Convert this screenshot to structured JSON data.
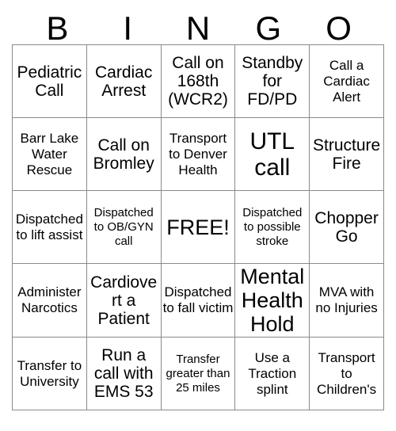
{
  "header": {
    "letters": [
      "B",
      "I",
      "N",
      "G",
      "O"
    ]
  },
  "grid": {
    "rows": [
      [
        {
          "text": "Pediatric Call",
          "size": "md"
        },
        {
          "text": "Cardiac Arrest",
          "size": "md"
        },
        {
          "text": "Call on 168th (WCR2)",
          "size": "md"
        },
        {
          "text": "Standby for FD/PD",
          "size": "md"
        },
        {
          "text": "Call a Cardiac Alert",
          "size": "sm"
        }
      ],
      [
        {
          "text": "Barr Lake Water Rescue",
          "size": "sm"
        },
        {
          "text": "Call on Bromley",
          "size": "md"
        },
        {
          "text": "Transport to Denver Health",
          "size": "sm"
        },
        {
          "text": "UTL call",
          "size": "xl"
        },
        {
          "text": "Structure Fire",
          "size": "md"
        }
      ],
      [
        {
          "text": "Dispatched to lift assist",
          "size": "sm"
        },
        {
          "text": "Dispatched to OB/GYN call",
          "size": "xs"
        },
        {
          "text": "FREE!",
          "size": "lg"
        },
        {
          "text": "Dispatched to possible stroke",
          "size": "xs"
        },
        {
          "text": "Chopper Go",
          "size": "md"
        }
      ],
      [
        {
          "text": "Administer Narcotics",
          "size": "sm"
        },
        {
          "text": "Cardiovert a Patient",
          "size": "md"
        },
        {
          "text": "Dispatched to fall victim",
          "size": "sm"
        },
        {
          "text": "Mental Health Hold",
          "size": "lg"
        },
        {
          "text": "MVA with no Injuries",
          "size": "sm"
        }
      ],
      [
        {
          "text": "Transfer to University",
          "size": "sm"
        },
        {
          "text": "Run a call with EMS 53",
          "size": "md"
        },
        {
          "text": "Transfer greater than 25 miles",
          "size": "xs"
        },
        {
          "text": "Use a Traction splint",
          "size": "sm"
        },
        {
          "text": "Transport to Children's",
          "size": "sm"
        }
      ]
    ]
  }
}
